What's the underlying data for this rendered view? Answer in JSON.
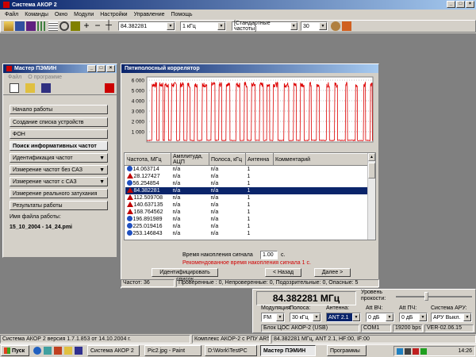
{
  "app": {
    "title": "Система АКОР 2",
    "menu": [
      "Файл",
      "Команды",
      "Окно",
      "Модули",
      "Настройки",
      "Управление",
      "Помощь"
    ],
    "toolbar": {
      "frequency": "84.382281",
      "step": "1 кГц",
      "preset": "[Стандартные частоты]",
      "level": "30"
    }
  },
  "wizard": {
    "title": "Мастер ПЭМИН",
    "menu": [
      "Файл",
      "О программе"
    ],
    "steps": [
      {
        "label": "Начало работы",
        "arrow": false
      },
      {
        "label": "Создание списка устройств",
        "arrow": false
      },
      {
        "label": "ФОН",
        "arrow": false
      },
      {
        "label": "Поиск информативных частот",
        "arrow": false,
        "active": true
      },
      {
        "label": "Идентификация частот",
        "arrow": true
      },
      {
        "label": "Измерение частот без САЗ",
        "arrow": true
      },
      {
        "label": "Измерение частот с САЗ",
        "arrow": true
      },
      {
        "label": "Измерение реального затухания",
        "arrow": false
      },
      {
        "label": "Результаты работы",
        "arrow": false
      }
    ],
    "file_label": "Имя файла работы:",
    "file_name": "15_10_2004 - 14_24.pmi"
  },
  "correlator": {
    "title": "Пятиполосный коррелятор",
    "columns": [
      "Частота, МГц",
      "Амплитуда, АЦП",
      "Полоса, кГц",
      "Антенна",
      "Комментарий"
    ],
    "rows": [
      {
        "icon": "question",
        "freq": "14.063714",
        "amp": "n/a",
        "band": "n/a",
        "ant": "1",
        "comment": ""
      },
      {
        "icon": "warning",
        "freq": "28.127427",
        "amp": "n/a",
        "band": "n/a",
        "ant": "1",
        "comment": ""
      },
      {
        "icon": "question",
        "freq": "56.254854",
        "amp": "n/a",
        "band": "n/a",
        "ant": "1",
        "comment": ""
      },
      {
        "icon": "warning",
        "freq": "84.382281",
        "amp": "n/a",
        "band": "n/a",
        "ant": "1",
        "comment": "",
        "selected": true
      },
      {
        "icon": "warning",
        "freq": "112.509708",
        "amp": "n/a",
        "band": "n/a",
        "ant": "1",
        "comment": ""
      },
      {
        "icon": "warning",
        "freq": "140.637135",
        "amp": "n/a",
        "band": "n/a",
        "ant": "1",
        "comment": ""
      },
      {
        "icon": "warning",
        "freq": "168.764562",
        "amp": "n/a",
        "band": "n/a",
        "ant": "1",
        "comment": ""
      },
      {
        "icon": "question",
        "freq": "196.891989",
        "amp": "n/a",
        "band": "n/a",
        "ant": "1",
        "comment": ""
      },
      {
        "icon": "question",
        "freq": "225.019416",
        "amp": "n/a",
        "band": "n/a",
        "ant": "1",
        "comment": ""
      },
      {
        "icon": "question",
        "freq": "253.146843",
        "amp": "n/a",
        "band": "n/a",
        "ant": "1",
        "comment": ""
      }
    ],
    "accum_label": "Время накопления сигнала",
    "accum_value": "1.00",
    "accum_unit": "с.",
    "recommend": "Рекомендованное время накопления сигнала 1 с.",
    "identify_btn": "Идентифицировать список",
    "back_btn": "< Назад",
    "next_btn": "Далее >",
    "status_count": "Частот: 36",
    "status_summary": "Проверенные : 0, Непроверенные: 0, Подозрительные: 0, Опасные: 5"
  },
  "chart_data": {
    "type": "line",
    "yticks": [
      "6 000",
      "5 000",
      "4 000",
      "3 000",
      "2 000",
      "1 000"
    ],
    "ylim": [
      0,
      6000
    ],
    "color": "#dd0000"
  },
  "receiver": {
    "frequency": "84.382281 МГц",
    "threshold_label": "Уровень прокости:",
    "labels": {
      "mod": "Модуляция:",
      "band": "Полоса:",
      "ant": "Антенна:",
      "att_hf": "Att ВЧ:",
      "att_if": "Att ПЧ:",
      "agc": "Система АРУ:"
    },
    "values": {
      "mod": "FM",
      "band": "30 кГц",
      "ant": "ANT 2.1",
      "att_hf": "0 дБ",
      "att_if": "0 дБ",
      "agc": "АРУ Выкл."
    },
    "block": "Блок ЦОС АКОР-2 (USB)",
    "port": "COM1",
    "baud": "19200 bps",
    "version": "VER-02.06.15"
  },
  "statusbar": {
    "version": "Система АКОР 2 версия 1.7.1.853 от 14.10.2004 г.",
    "complex": "Комплекс АКОР-2 с РПУ AR5000",
    "params": "84.382281 МГц, ANT 2.1, HF:00, IF:00"
  },
  "taskbar": {
    "start": "Пуск",
    "tasks": [
      "Система АКОР 2",
      "Pic2.jpg - Paint",
      "D:\\Work\\TestPC",
      "Мастер ПЭМИН",
      "Программы"
    ],
    "clock": "14:26"
  },
  "colors": {
    "title_start": "#0a246a",
    "title_end": "#a6caf0",
    "selection": "#0a246a",
    "signal": "#dd0000"
  }
}
